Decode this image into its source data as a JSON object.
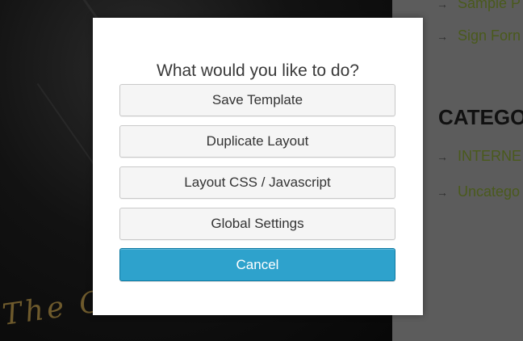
{
  "background": {
    "script_text": "The Original",
    "recent_posts": [
      {
        "label": "Sample P",
        "icon": "arrow-right-icon"
      },
      {
        "label": "Sign Forn",
        "icon": "arrow-right-icon"
      }
    ],
    "categories_heading": "CATEGO",
    "categories": [
      {
        "label": "INTERNE",
        "icon": "arrow-right-icon"
      },
      {
        "label": "Uncatego",
        "icon": "arrow-right-icon"
      }
    ]
  },
  "modal": {
    "title": "What would you like to do?",
    "buttons": {
      "save_template": "Save Template",
      "duplicate_layout": "Duplicate Layout",
      "layout_css_js": "Layout CSS / Javascript",
      "global_settings": "Global Settings",
      "cancel": "Cancel"
    }
  },
  "colors": {
    "primary_button": "#2ea2cc",
    "link_text": "#4a5a1c",
    "overlay": "#000000"
  }
}
